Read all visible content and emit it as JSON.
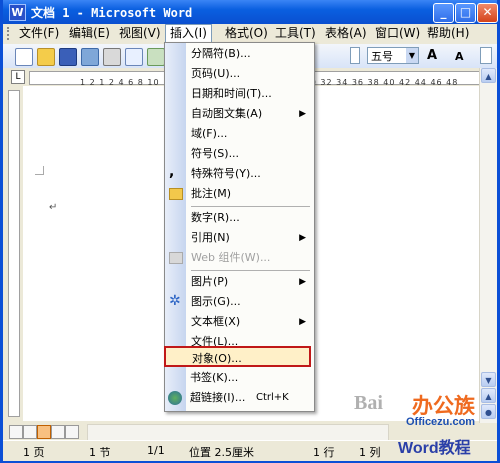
{
  "window": {
    "title": "文档 1 - Microsoft Word",
    "title_icon": "W",
    "minimize": "_",
    "maximize": "□",
    "close": "✕"
  },
  "menubar": {
    "items": [
      "文件(F)",
      "编辑(E)",
      "视图(V)",
      "插入(I)",
      "格式(O)",
      "工具(T)",
      "表格(A)",
      "窗口(W)",
      "帮助(H)"
    ],
    "active": "插入(I)"
  },
  "toolbar": {
    "font_size": "五号",
    "grow_font": "A",
    "shrink_font": "A"
  },
  "ruler": {
    "tab_marker": "L",
    "ticks": "1 2 1 2 4 6 8 10 12 14 16 18 20 22 24 26 28 30 32 34 36 38 40 42 44 46 48"
  },
  "insert_menu": {
    "items": [
      {
        "label": "分隔符(B)...",
        "icon": "none",
        "submenu": false,
        "enabled": true
      },
      {
        "label": "页码(U)...",
        "icon": "none",
        "submenu": false,
        "enabled": true
      },
      {
        "label": "日期和时间(T)...",
        "icon": "none",
        "submenu": false,
        "enabled": true
      },
      {
        "label": "自动图文集(A)",
        "icon": "none",
        "submenu": true,
        "enabled": true
      },
      {
        "label": "域(F)...",
        "icon": "none",
        "submenu": false,
        "enabled": true
      },
      {
        "label": "符号(S)...",
        "icon": "none",
        "submenu": false,
        "enabled": true
      },
      {
        "label": "特殊符号(Y)...",
        "icon": "comma-icon",
        "submenu": false,
        "enabled": true
      },
      {
        "label": "批注(M)",
        "icon": "folder-icon",
        "submenu": false,
        "enabled": true
      },
      {
        "label": "数字(R)...",
        "icon": "none",
        "submenu": false,
        "enabled": true
      },
      {
        "label": "引用(N)",
        "icon": "none",
        "submenu": true,
        "enabled": true
      },
      {
        "label": "Web 组件(W)...",
        "icon": "web-component-icon",
        "submenu": false,
        "enabled": false
      },
      {
        "label": "图片(P)",
        "icon": "none",
        "submenu": true,
        "enabled": true
      },
      {
        "label": "图示(G)...",
        "icon": "diagram-icon",
        "submenu": false,
        "enabled": true
      },
      {
        "label": "文本框(X)",
        "icon": "none",
        "submenu": true,
        "enabled": true
      },
      {
        "label": "文件(L)...",
        "icon": "none",
        "submenu": false,
        "enabled": true
      },
      {
        "label": "对象(O)...",
        "icon": "none",
        "submenu": false,
        "enabled": true
      },
      {
        "label": "书签(K)...",
        "icon": "none",
        "submenu": false,
        "enabled": true
      },
      {
        "label": "超链接(I)...",
        "icon": "globe-link-icon",
        "shortcut": "Ctrl+K",
        "submenu": false,
        "enabled": true
      }
    ],
    "highlighted": "对象(O)..."
  },
  "document": {
    "paragraph_mark": "↵"
  },
  "statusbar": {
    "page": "1 页",
    "section": "1 节",
    "page_of": "1/1",
    "position": "位置 2.5厘米",
    "line": "1 行",
    "column": "1 列"
  },
  "watermark": {
    "baidu": "Bai",
    "logo": "办公族",
    "site": "Officezu.com",
    "brand": "Word教程"
  }
}
